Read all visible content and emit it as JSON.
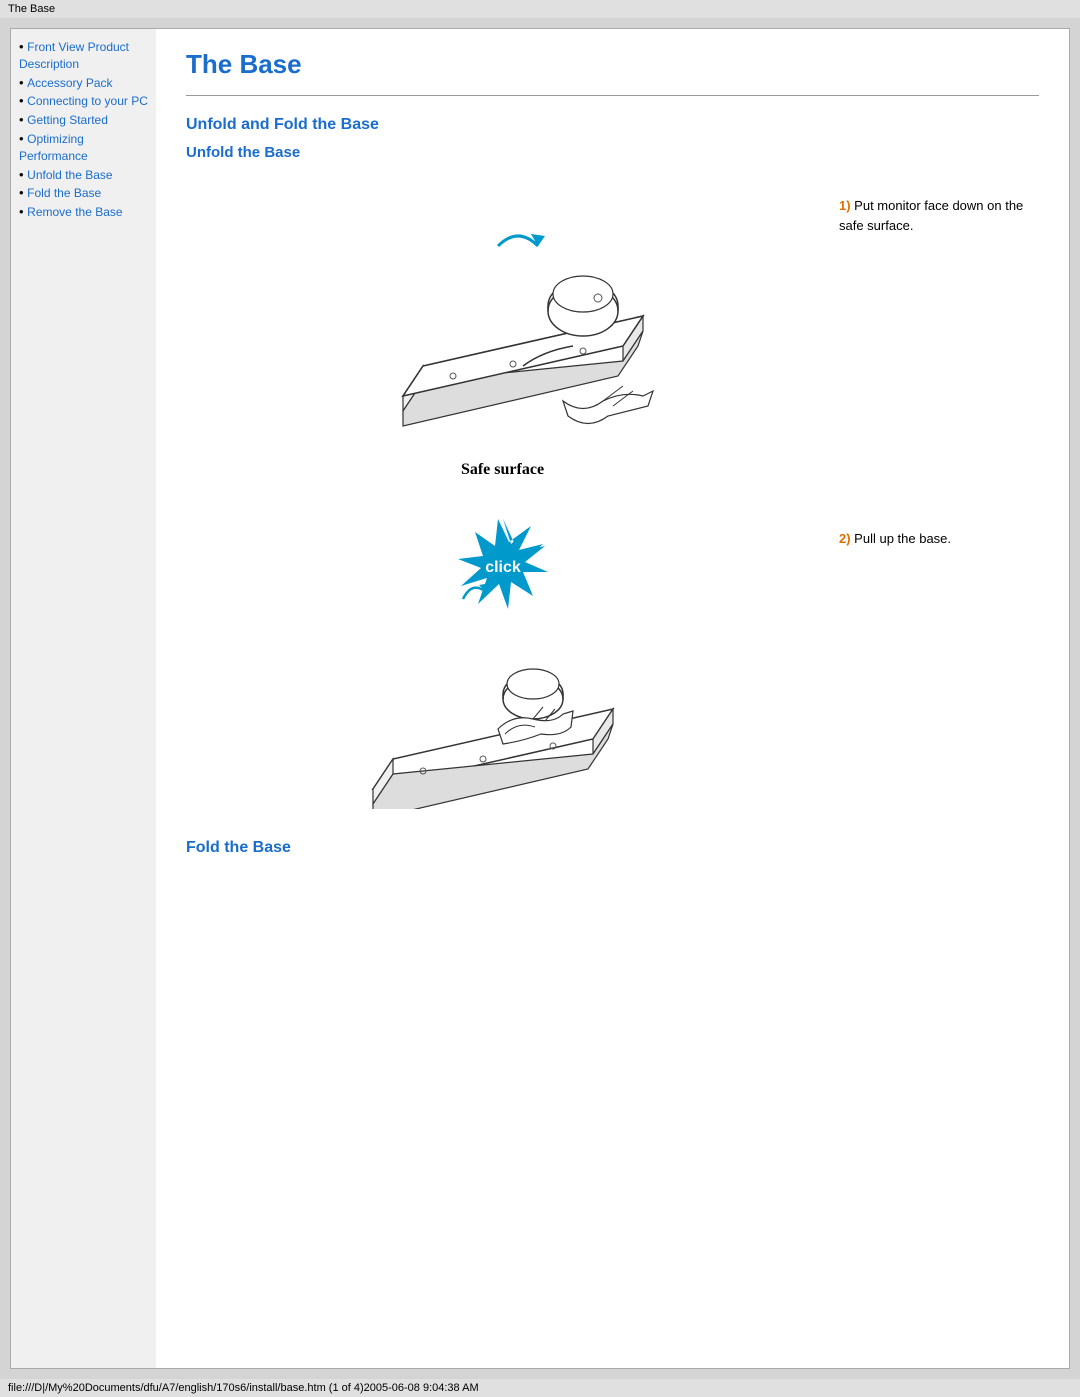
{
  "titleBar": {
    "text": "The Base"
  },
  "statusBar": {
    "text": "file:///D|/My%20Documents/dfu/A7/english/170s6/install/base.htm (1 of 4)2005-06-08 9:04:38 AM"
  },
  "page": {
    "title": "The Base",
    "sectionTitle": "Unfold and Fold the Base",
    "subsectionTitle1": "Unfold the Base",
    "subsectionTitle2": "Fold the Base",
    "step1Number": "1)",
    "step1Text": " Put monitor face down on the safe surface.",
    "step2Number": "2)",
    "step2Text": " Pull up the base.",
    "safeSurfaceLabel": "Safe surface"
  },
  "sidebar": {
    "items": [
      {
        "label": "Front View Product Description",
        "href": "#"
      },
      {
        "label": "Accessory Pack",
        "href": "#"
      },
      {
        "label": "Connecting to your PC",
        "href": "#"
      },
      {
        "label": "Getting Started",
        "href": "#"
      },
      {
        "label": "Optimizing Performance",
        "href": "#"
      },
      {
        "label": "Unfold the Base",
        "href": "#"
      },
      {
        "label": "Fold the Base",
        "href": "#"
      },
      {
        "label": "Remove the Base",
        "href": "#"
      }
    ]
  }
}
